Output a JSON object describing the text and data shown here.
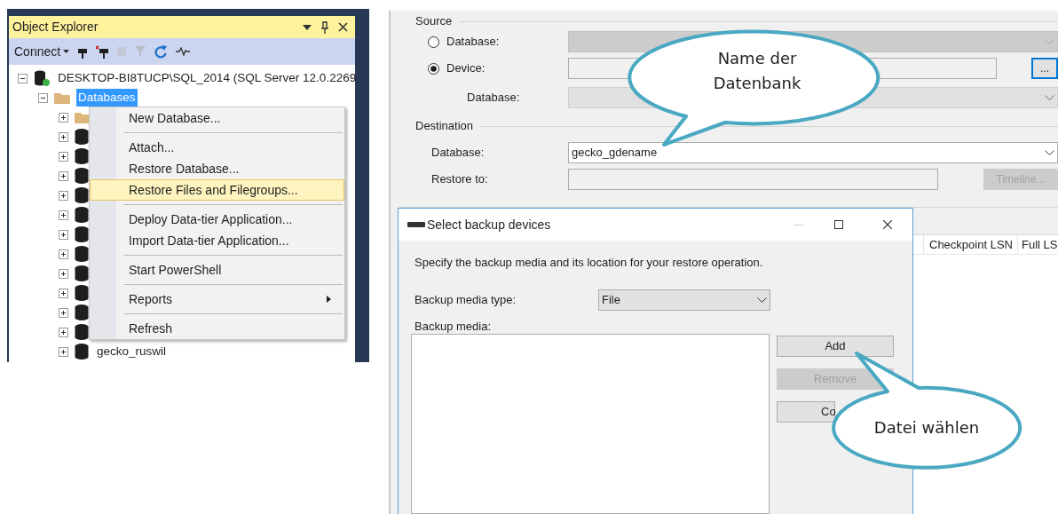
{
  "object_explorer": {
    "title": "Object Explorer",
    "toolbar": {
      "connect": "Connect"
    },
    "tree": [
      {
        "kind": "server",
        "label": "DESKTOP-BI8TUCP\\SQL_2014 (SQL Server 12.0.2269",
        "expanded": true,
        "selected": false,
        "children": [
          {
            "kind": "folder",
            "label": "Databases",
            "expanded": true,
            "selected": true,
            "children": [
              {
                "kind": "folder",
                "expanded": false
              },
              {
                "kind": "database",
                "expanded": false
              },
              {
                "kind": "database",
                "expanded": false
              },
              {
                "kind": "database",
                "expanded": false
              },
              {
                "kind": "database",
                "expanded": false
              },
              {
                "kind": "database",
                "expanded": false
              },
              {
                "kind": "database",
                "expanded": false
              },
              {
                "kind": "database",
                "expanded": false
              },
              {
                "kind": "database",
                "expanded": false
              },
              {
                "kind": "database",
                "expanded": false
              },
              {
                "kind": "database",
                "expanded": false
              },
              {
                "kind": "database",
                "expanded": false
              },
              {
                "kind": "database",
                "label": "gecko_ruswil",
                "expanded": false,
                "selected": false
              }
            ]
          }
        ]
      }
    ]
  },
  "context_menu": {
    "groups": [
      [
        {
          "label": "New Database...",
          "selected": false
        }
      ],
      [
        {
          "label": "Attach...",
          "selected": false
        },
        {
          "label": "Restore Database...",
          "selected": false
        },
        {
          "label": "Restore Files and Filegroups...",
          "selected": true
        }
      ],
      [
        {
          "label": "Deploy Data-tier Application...",
          "selected": false
        },
        {
          "label": "Import Data-tier Application...",
          "selected": false
        }
      ],
      [
        {
          "label": "Start PowerShell",
          "selected": false
        }
      ],
      [
        {
          "label": "Reports",
          "selected": false,
          "kind": "submenu"
        }
      ],
      [
        {
          "label": "Refresh",
          "selected": false
        }
      ]
    ]
  },
  "restore_dialog": {
    "source": {
      "title": "Source",
      "options": [
        {
          "label": "Database:",
          "selected": false
        },
        {
          "label": "Device:",
          "selected": true
        }
      ],
      "browse_button": "...",
      "database_label": "Database:"
    },
    "destination": {
      "title": "Destination",
      "database_label": "Database:",
      "database_value": "gecko_gdename",
      "restore_to_label": "Restore to:",
      "timeline_button": {
        "label": "Timeline...",
        "disabled": true
      }
    },
    "grid_columns": [
      "Checkpoint LSN",
      "Full LS"
    ]
  },
  "backup_dialog": {
    "title": "Select backup devices",
    "description": "Specify the backup media and its location for your restore operation.",
    "media_type_label": "Backup media type:",
    "media_type_value": "File",
    "media_label": "Backup media:",
    "buttons": [
      {
        "label": "Add",
        "disabled": false
      },
      {
        "label": "Remove",
        "disabled": true
      },
      {
        "label": "Co",
        "disabled": false
      }
    ]
  },
  "callouts": [
    {
      "text": "Name der Datenbank"
    },
    {
      "text": "Datei wählen"
    }
  ]
}
